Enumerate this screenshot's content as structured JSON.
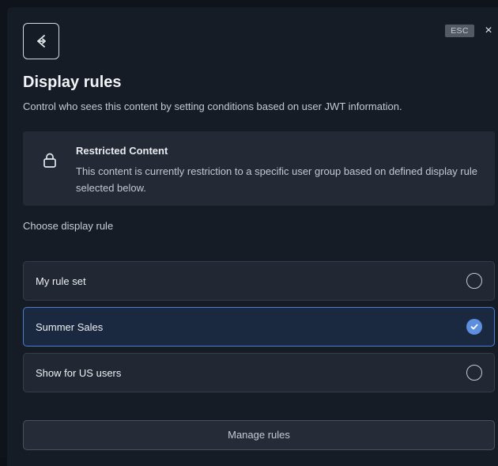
{
  "header": {
    "icon": "share-nodes-icon",
    "esc_label": "ESC",
    "close_glyph": "×"
  },
  "title": "Display rules",
  "subtitle": "Control who sees this content by setting conditions based on user JWT information.",
  "notice": {
    "icon": "lock-icon",
    "title": "Restricted Content",
    "body": "This content is currently restriction to a specific user group based on defined display rule selected below."
  },
  "choose_label": "Choose display rule",
  "rules": [
    {
      "label": "My rule set",
      "selected": false
    },
    {
      "label": "Summer Sales",
      "selected": true
    },
    {
      "label": "Show for US users",
      "selected": false
    }
  ],
  "manage_button": "Manage rules",
  "colors": {
    "accent": "#5d8fe0",
    "selected_border": "#4a7fd0",
    "panel_bg": "#161c25"
  }
}
